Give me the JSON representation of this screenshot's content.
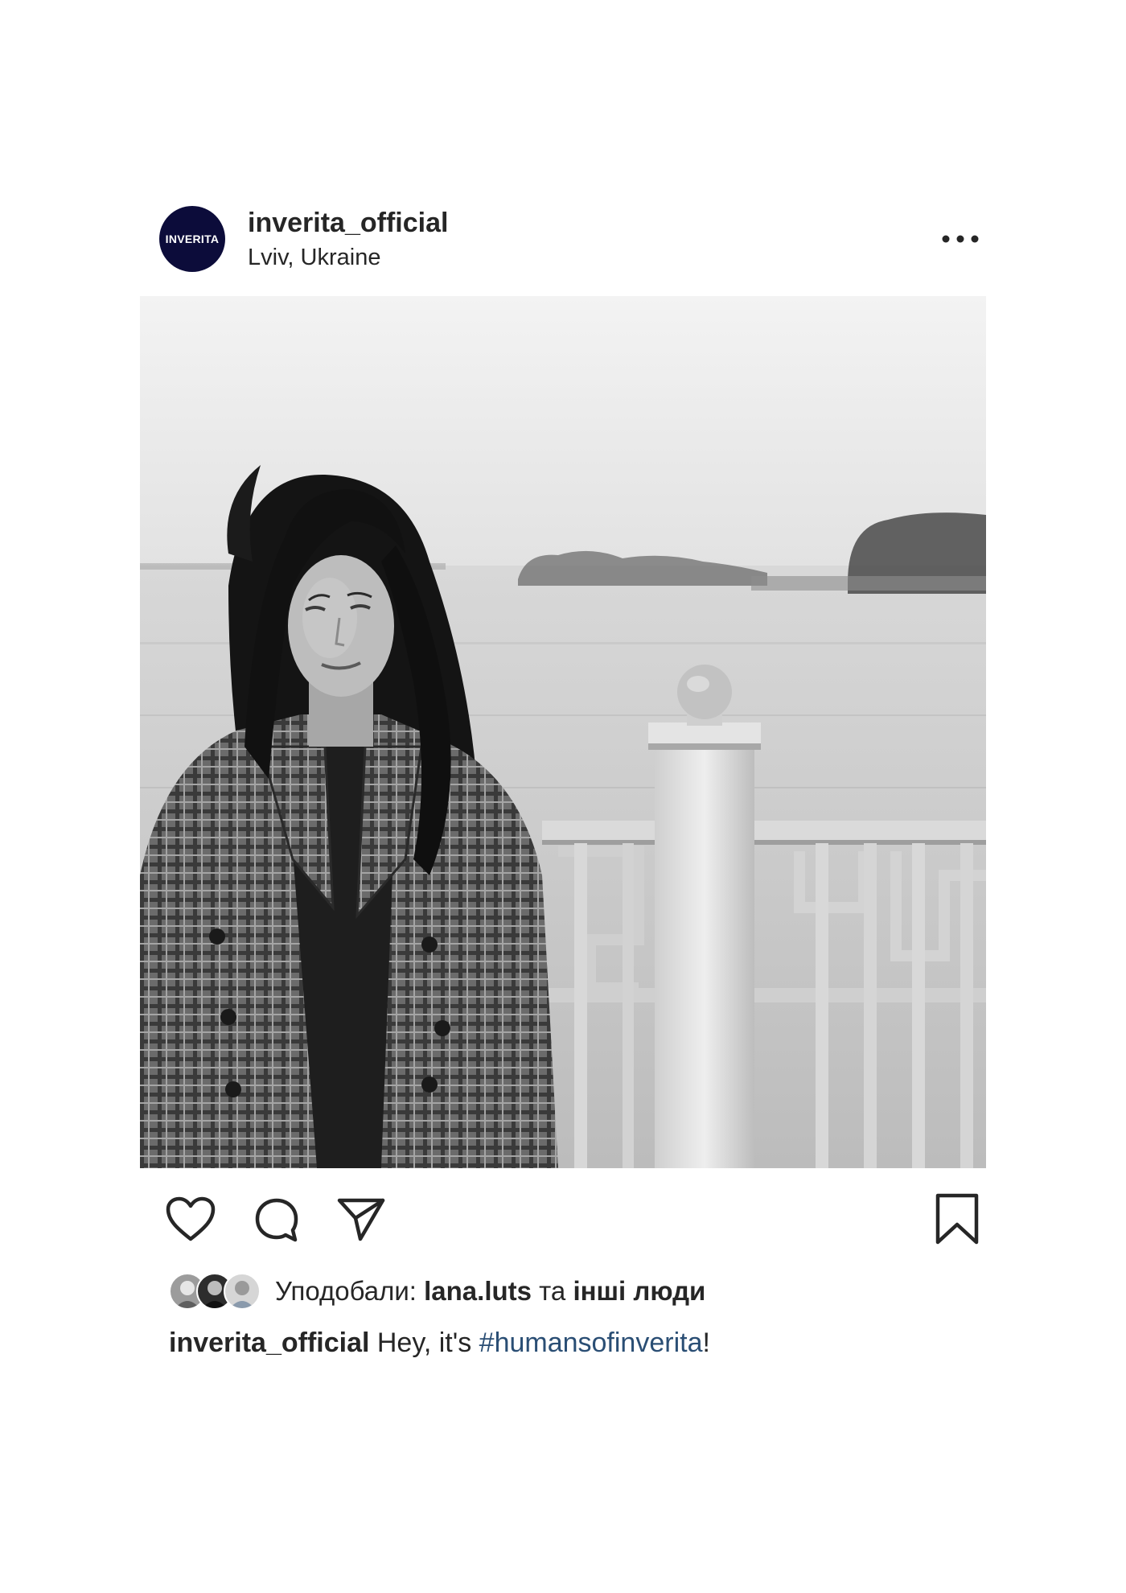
{
  "post": {
    "avatar_text": "INVERITA",
    "username": "inverita_official",
    "location": "Lviv, Ukraine",
    "more_icon": "ellipsis-icon",
    "photo_alt": "Black and white portrait of a woman by a riverside railing",
    "actions": {
      "like_icon": "heart-outline-icon",
      "comment_icon": "comment-bubble-icon",
      "share_icon": "paper-plane-icon",
      "save_icon": "bookmark-outline-icon"
    },
    "likes": {
      "prefix": "Уподобали:",
      "first_user": "lana.luts",
      "joiner": "та",
      "others": "інші люди"
    },
    "caption": {
      "username": "inverita_official",
      "text": "Hey, it's",
      "hashtag": "#humansofinverita",
      "suffix": "!"
    }
  },
  "colors": {
    "text": "#262626",
    "hashtag": "#2a4e74",
    "avatar_bg": "#0c0c3a",
    "background": "#ffffff"
  }
}
